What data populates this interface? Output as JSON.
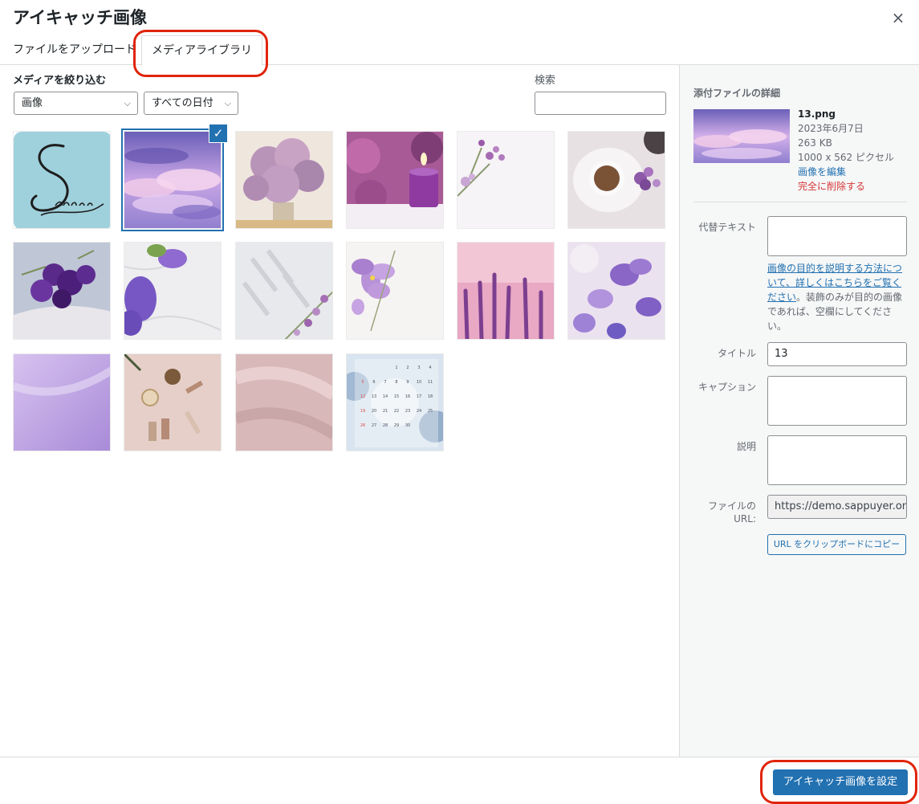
{
  "modal": {
    "title": "アイキャッチ画像",
    "close_glyph": "×"
  },
  "tabs": [
    {
      "label": "ファイルをアップロード"
    },
    {
      "label": "メディアライブラリ"
    }
  ],
  "filter": {
    "heading": "メディアを絞り込む",
    "type_select": "画像",
    "date_select": "すべての日付",
    "search_label": "検索",
    "search_value": ""
  },
  "media_items": [
    {
      "name": "sappuyer-logo",
      "selected": false
    },
    {
      "name": "purple-sky-clouds",
      "selected": true
    },
    {
      "name": "lilac-bouquet",
      "selected": false
    },
    {
      "name": "purple-candle",
      "selected": false
    },
    {
      "name": "flower-sprig-white",
      "selected": false
    },
    {
      "name": "coffee-cup-lilac",
      "selected": false
    },
    {
      "name": "lavender-book",
      "selected": false
    },
    {
      "name": "violet-marble",
      "selected": false
    },
    {
      "name": "shadow-flowers",
      "selected": false
    },
    {
      "name": "violet-white-bg",
      "selected": false
    },
    {
      "name": "lavender-field",
      "selected": false
    },
    {
      "name": "purple-bellflowers",
      "selected": false
    },
    {
      "name": "purple-gradient",
      "selected": false
    },
    {
      "name": "cosmetics-flatlay",
      "selected": false
    },
    {
      "name": "pink-satin",
      "selected": false
    },
    {
      "name": "calendar-blue-floral",
      "selected": false
    }
  ],
  "calendar_numbers": [
    "1",
    "2",
    "3",
    "4",
    "5",
    "6",
    "7",
    "8",
    "9",
    "10",
    "11",
    "12",
    "13",
    "14",
    "15",
    "16",
    "17",
    "18",
    "19",
    "20",
    "21",
    "22",
    "23",
    "24",
    "25",
    "26",
    "27",
    "28",
    "29",
    "30"
  ],
  "details": {
    "heading": "添付ファイルの詳細",
    "filename": "13.png",
    "date": "2023年6月7日",
    "size": "263 KB",
    "dimensions": "1000 x 562 ピクセル",
    "edit_link": "画像を編集",
    "delete_link": "完全に削除する",
    "alt_label": "代替テキスト",
    "alt_value": "",
    "help_link": "画像の目的を説明する方法について、詳しくはこちらをご覧ください",
    "help_text": "。装飾のみが目的の画像であれば、空欄にしてください。",
    "title_label": "タイトル",
    "title_value": "13",
    "caption_label": "キャプション",
    "caption_value": "",
    "description_label": "説明",
    "description_value": "",
    "url_label": "ファイルの URL:",
    "url_value": "https://demo.sappuyer.on",
    "copy_button": "URL をクリップボードにコピー"
  },
  "footer": {
    "primary_button": "アイキャッチ画像を設定"
  },
  "colors": {
    "accent": "#2271b1",
    "danger": "#d63638",
    "highlight": "#e0240a"
  }
}
